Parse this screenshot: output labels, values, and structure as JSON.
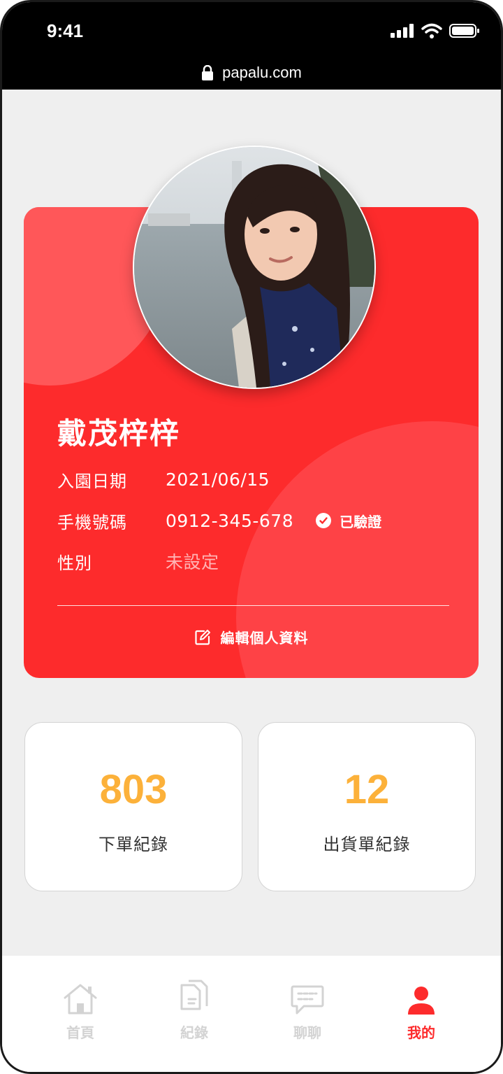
{
  "status_bar": {
    "time": "9:41"
  },
  "browser": {
    "url": "papalu.com"
  },
  "profile": {
    "name": "戴茂梓梓",
    "join_date_label": "入園日期",
    "join_date": "2021/06/15",
    "phone_label": "手機號碼",
    "phone": "0912-345-678",
    "verified_label": "已驗證",
    "gender_label": "性別",
    "gender": "未設定",
    "edit_label": "編輯個人資料"
  },
  "stats": [
    {
      "value": "803",
      "label": "下單紀錄"
    },
    {
      "value": "12",
      "label": "出貨單紀錄"
    }
  ],
  "nav": [
    {
      "label": "首頁",
      "icon": "home-icon"
    },
    {
      "label": "紀錄",
      "icon": "documents-icon"
    },
    {
      "label": "聊聊",
      "icon": "chat-icon"
    },
    {
      "label": "我的",
      "icon": "user-icon",
      "active": true
    }
  ],
  "colors": {
    "brand_red": "#fd2b2c",
    "stat_orange": "#fcb13a",
    "nav_inactive": "#d3d3d3"
  }
}
